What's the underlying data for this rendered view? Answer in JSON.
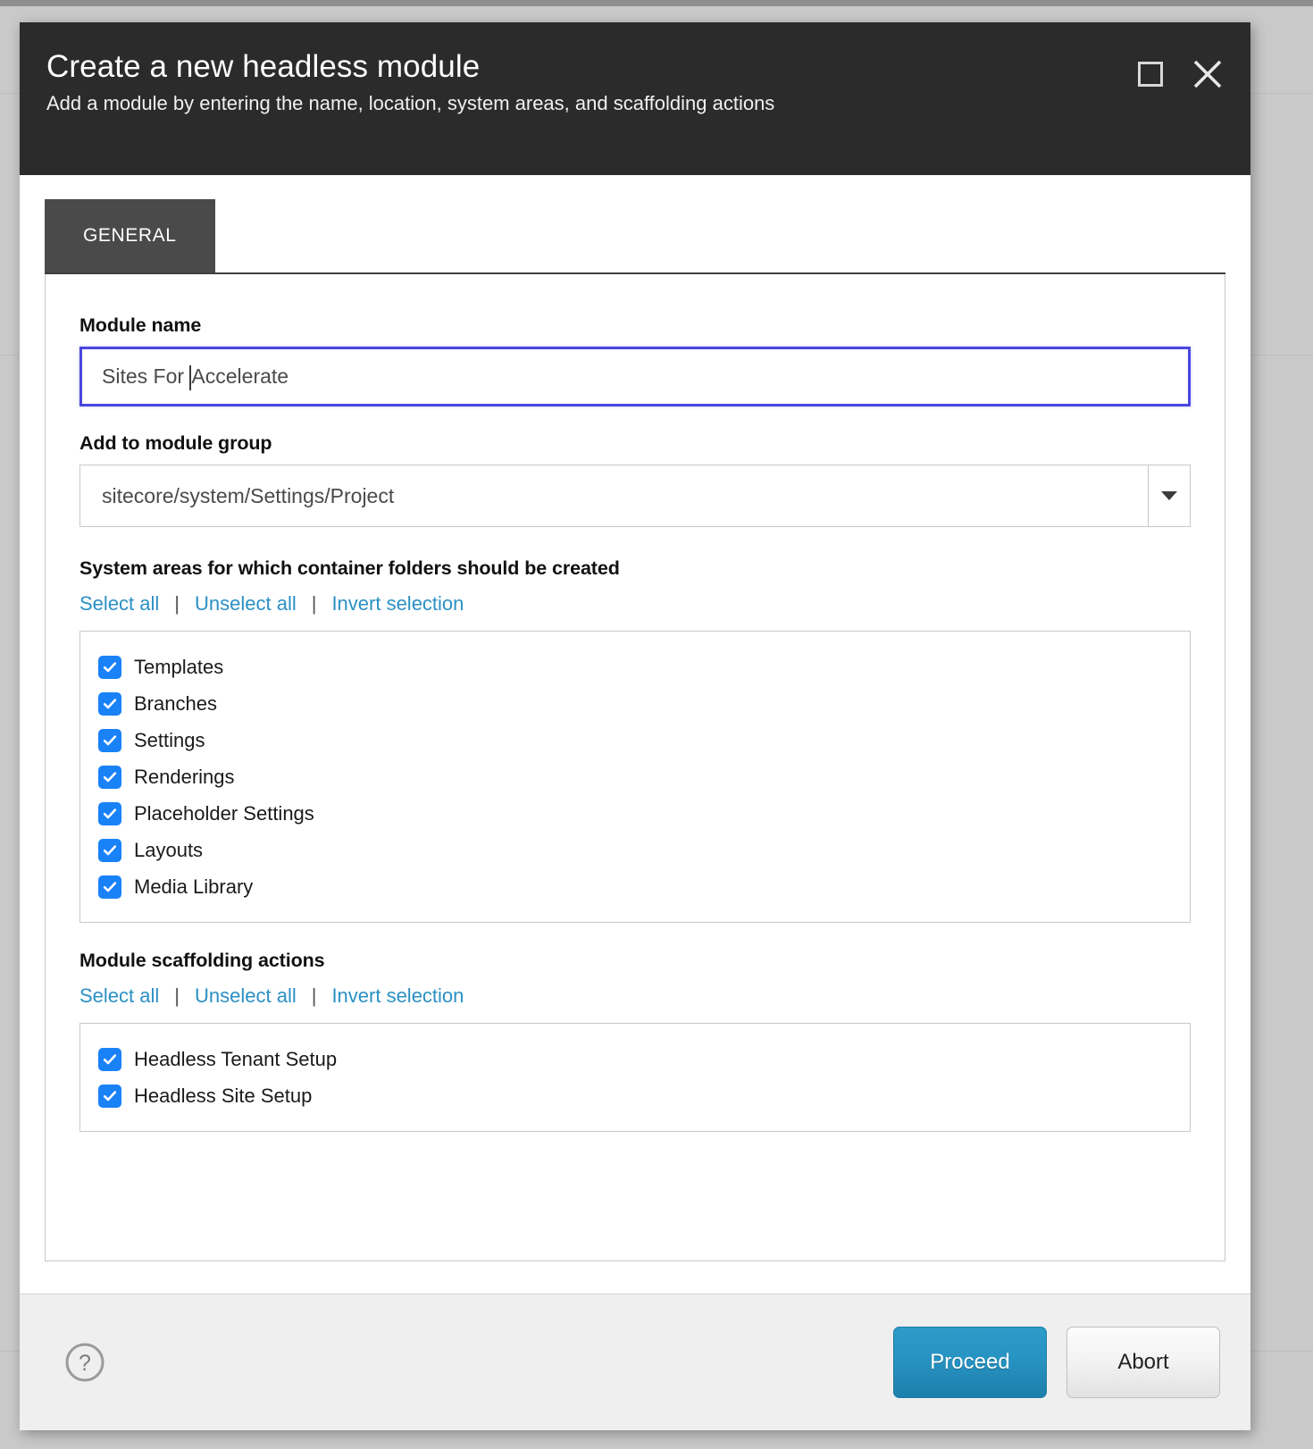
{
  "dialog": {
    "title": "Create a new headless module",
    "subtitle": "Add a module by entering the name, location, system areas, and scaffolding actions",
    "window_controls": {
      "maximize": "maximize",
      "close": "close"
    }
  },
  "tabs": [
    {
      "label": "GENERAL",
      "active": true
    }
  ],
  "form": {
    "module_name": {
      "label": "Module name",
      "value_before_caret": "Sites For ",
      "value_after_caret": "Accelerate",
      "full_value": "Sites For Accelerate",
      "placeholder": "Module name"
    },
    "module_group": {
      "label": "Add to module group",
      "value": "sitecore/system/Settings/Project",
      "arrow_icon": "chevron-down-icon"
    },
    "system_areas": {
      "label": "System areas for which container folders should be created",
      "actions": {
        "select_all": "Select all",
        "unselect_all": "Unselect all",
        "invert_selection": "Invert selection",
        "separator": "|"
      },
      "items": [
        {
          "label": "Templates",
          "checked": true
        },
        {
          "label": "Branches",
          "checked": true
        },
        {
          "label": "Settings",
          "checked": true
        },
        {
          "label": "Renderings",
          "checked": true
        },
        {
          "label": "Placeholder Settings",
          "checked": true
        },
        {
          "label": "Layouts",
          "checked": true
        },
        {
          "label": "Media Library",
          "checked": true
        }
      ]
    },
    "scaffolding_actions": {
      "label": "Module scaffolding actions",
      "actions": {
        "select_all": "Select all",
        "unselect_all": "Unselect all",
        "invert_selection": "Invert selection",
        "separator": "|"
      },
      "items": [
        {
          "label": "Headless Tenant Setup",
          "checked": true
        },
        {
          "label": "Headless Site Setup",
          "checked": true
        }
      ]
    }
  },
  "footer": {
    "help_icon": "help-circle-icon",
    "proceed_label": "Proceed",
    "abort_label": "Abort"
  },
  "colors": {
    "titlebar_bg": "#2b2b2b",
    "tab_active_bg": "#4a4a4a",
    "link_blue": "#2b90c4",
    "checkbox_blue": "#1a82f7",
    "focus_border": "#4b46e0",
    "primary_button": "#2793c2",
    "footer_bg": "#efefef"
  }
}
